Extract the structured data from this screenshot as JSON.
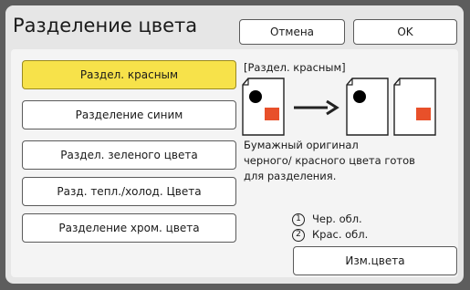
{
  "header": {
    "title": "Разделение цвета",
    "cancel_label": "Отмена",
    "ok_label": "OK"
  },
  "options": [
    {
      "label": "Раздел. красным",
      "selected": true
    },
    {
      "label": "Разделение синим",
      "selected": false
    },
    {
      "label": "Раздел. зеленого цвета",
      "selected": false
    },
    {
      "label": "Разд. тепл./холод. Цвета",
      "selected": false
    },
    {
      "label": "Разделение хром. цвета",
      "selected": false
    }
  ],
  "description": {
    "title": "[Раздел. красным]",
    "lines": [
      "Бумажный оригинал",
      "черного/ красного цвета готов",
      "для разделения."
    ]
  },
  "legend": {
    "items": [
      {
        "marker": "1",
        "text": "Чер. обл."
      },
      {
        "marker": "2",
        "text": "Крас. обл."
      }
    ]
  },
  "edit_color_label": "Изм.цвета",
  "colors": {
    "selected_button": "#f7e24a",
    "red_area": "#e8502a",
    "black_area": "#000000"
  }
}
